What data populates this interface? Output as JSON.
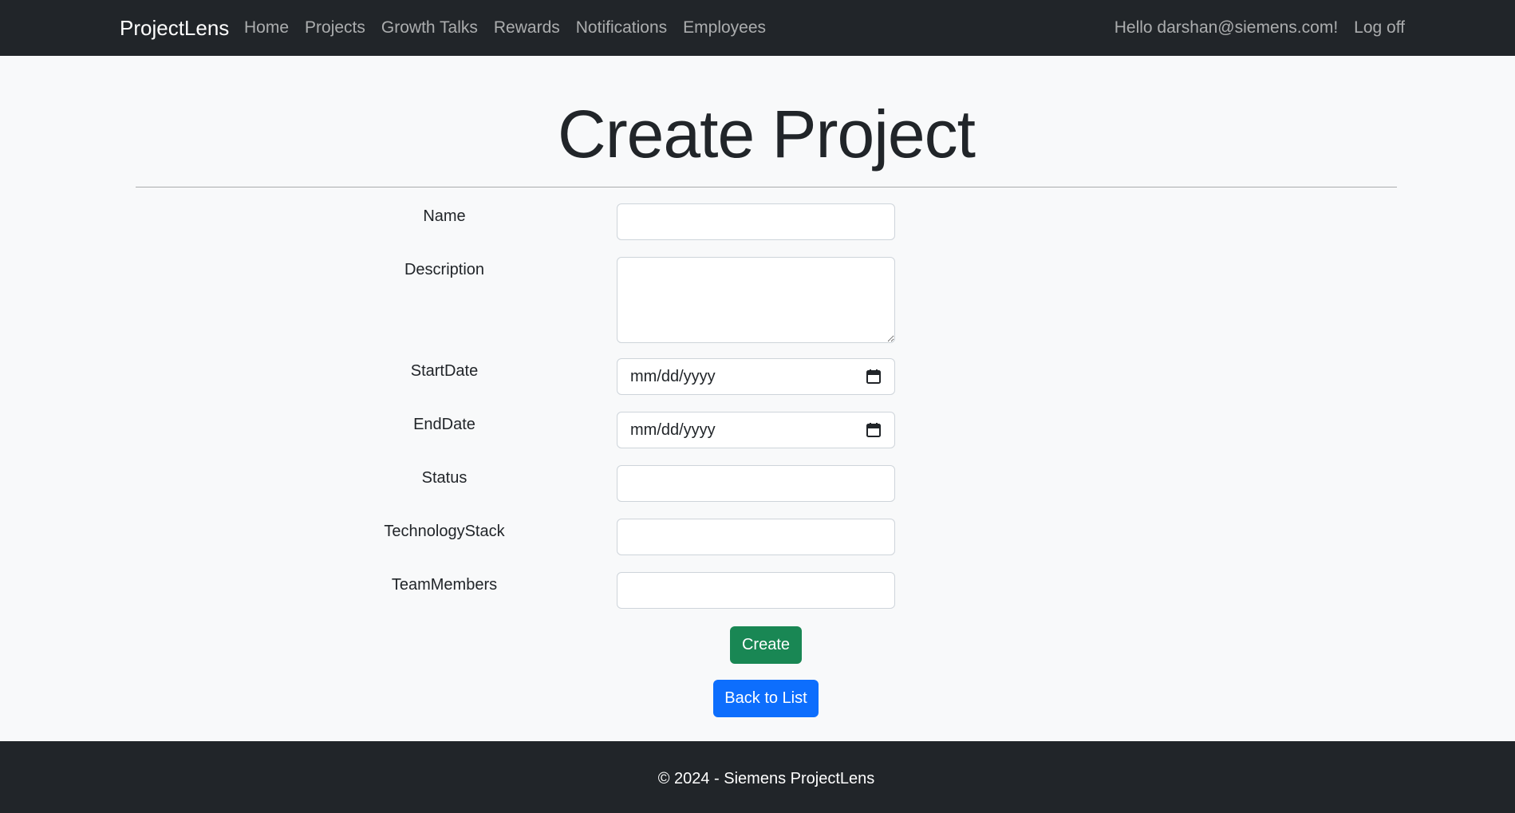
{
  "navbar": {
    "brand": "ProjectLens",
    "links": [
      "Home",
      "Projects",
      "Growth Talks",
      "Rewards",
      "Notifications",
      "Employees"
    ],
    "greeting": "Hello darshan@siemens.com!",
    "logoff": "Log off"
  },
  "page": {
    "title": "Create Project"
  },
  "form": {
    "name_label": "Name",
    "name_value": "",
    "description_label": "Description",
    "description_value": "",
    "startdate_label": "StartDate",
    "startdate_value": "mm/dd/yyyy",
    "enddate_label": "EndDate",
    "enddate_value": "mm/dd/yyyy",
    "status_label": "Status",
    "status_value": "",
    "technologystack_label": "TechnologyStack",
    "technologystack_value": "",
    "teammembers_label": "TeamMembers",
    "teammembers_value": "",
    "create_label": "Create",
    "back_label": "Back to List"
  },
  "footer": {
    "text": "© 2024 - Siemens ProjectLens"
  },
  "icons": {
    "calendar": "calendar-icon",
    "resize": "resize-grip-icon"
  },
  "colors": {
    "navbar_bg": "#212529",
    "page_bg": "#f8f9fa",
    "create_button": "#198754",
    "back_button": "#0d6efd"
  }
}
